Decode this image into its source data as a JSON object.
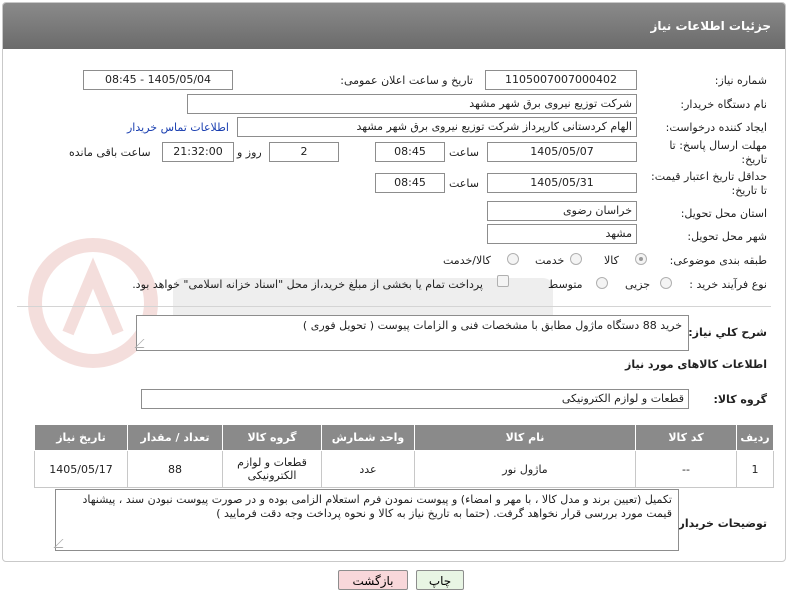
{
  "header": {
    "title": "جزئیات اطلاعات نیاز"
  },
  "form": {
    "need_number": {
      "label": "شماره نیاز:",
      "value": "1105007007000402"
    },
    "announce_datetime": {
      "label": "تاریخ و ساعت اعلان عمومی:",
      "value": "1405/05/04 - 08:45"
    },
    "buyer_org": {
      "label": "نام دستگاه خریدار:",
      "value": "شرکت توزیع نیروی برق شهر مشهد"
    },
    "requester": {
      "label": "ایجاد کننده درخواست:",
      "value": "الهام کردستانی کارپرداز شرکت توزیع نیروی برق شهر مشهد",
      "contact_link": "اطلاعات تماس خریدار"
    },
    "deadline": {
      "label": "مهلت ارسال پاسخ: تا تاریخ:",
      "date": "1405/05/07",
      "time_label": "ساعت",
      "time": "08:45",
      "days": "2",
      "days_label": "روز و",
      "remaining": "21:32:00",
      "remaining_label": "ساعت باقی مانده"
    },
    "price_validity": {
      "label": "حداقل تاریخ اعتبار قیمت: تا تاریخ:",
      "date": "1405/05/31",
      "time_label": "ساعت",
      "time": "08:45"
    },
    "province": {
      "label": "استان محل تحویل:",
      "value": "خراسان رضوی"
    },
    "city": {
      "label": "شهر محل تحویل:",
      "value": "مشهد"
    },
    "category": {
      "label": "طبقه بندی موضوعی:",
      "options": [
        "کالا",
        "خدمت",
        "کالا/خدمت"
      ],
      "selected": "کالا"
    },
    "purchase_type": {
      "label": "نوع فرآیند خرید :",
      "options": [
        "جزیی",
        "متوسط"
      ],
      "selected": "",
      "payment_note": "پرداخت تمام یا بخشی از مبلغ خرید،از محل \"اسناد خزانه اسلامی\" خواهد بود."
    }
  },
  "summary": {
    "label": "شرح کلي نياز:",
    "value": "خرید 88 دستگاه ماژول مطابق با مشخصات فنی و الزامات پیوست ( تحویل فوری )"
  },
  "goods_section": {
    "title": "اطلاعات کالاهای مورد نیاز",
    "group_label": "گروه کالا:",
    "group_value": "قطعات و لوازم الکترونیکی"
  },
  "table": {
    "headers": [
      "ردیف",
      "کد کالا",
      "نام کالا",
      "واحد شمارش",
      "گروه کالا",
      "تعداد / مقدار",
      "تاریخ نیاز"
    ],
    "rows": [
      {
        "row": "1",
        "code": "--",
        "name": "ماژول نور",
        "unit": "عدد",
        "group": "قطعات و لوازم الکترونیکی",
        "qty": "88",
        "date": "1405/05/17"
      }
    ]
  },
  "buyer_notes": {
    "label": "توضیحات خریدار:",
    "value": "تکمیل (تعیین برند و مدل کالا ، با مهر و امضاء) و پیوست نمودن فرم استعلام الزامی بوده و در صورت پیوست نبودن سند ، پیشنهاد قیمت مورد بررسی قرار نخواهد گرفت. (حتما به تاریخ نیاز به کالا و نحوه پرداخت وجه دقت فرمایید )"
  },
  "buttons": {
    "print": "چاپ",
    "back": "بازگشت"
  },
  "colors": {
    "header": "#7a7a7a",
    "back_button_bg": "#f8d7da",
    "print_button_bg": "#e8f5e4"
  }
}
